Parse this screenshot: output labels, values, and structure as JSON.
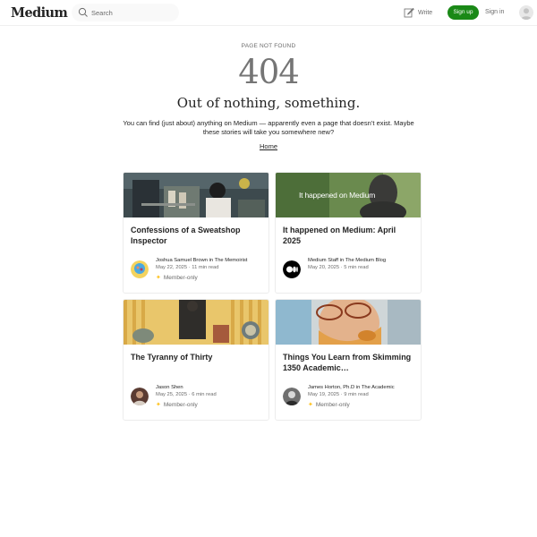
{
  "header": {
    "logo": "Medium",
    "search_placeholder": "Search",
    "write_label": "Write",
    "signup_label": "Sign up",
    "signin_label": "Sign in"
  },
  "not_found": {
    "label": "PAGE NOT FOUND",
    "code": "404",
    "title": "Out of nothing, something.",
    "description": "You can find (just about) anything on Medium — apparently even a page that doesn’t exist. Maybe these stories will take you somewhere new?",
    "home_link": "Home"
  },
  "stories": [
    {
      "title": "Confessions of a Sweatshop Inspector",
      "author": "Joshua Samuel Brown",
      "publication": "The Memoirist",
      "date": "May 22, 2025",
      "read_time": "11 min read",
      "member_only": "Member-only"
    },
    {
      "title": "It happened on Medium: April 2025",
      "author": "Medium Staff",
      "publication": "The Medium Blog",
      "date": "May 20, 2025",
      "read_time": "5 min read",
      "image_text": "It happened on Medium"
    },
    {
      "title": "The Tyranny of Thirty",
      "author": "Jason Shen",
      "publication": "",
      "date": "May 25, 2025",
      "read_time": "6 min read",
      "member_only": "Member-only"
    },
    {
      "title": "Things You Learn from Skimming 1350 Academic…",
      "author": "James Horton, Ph.D",
      "publication": "The Academic",
      "date": "May 19, 2025",
      "read_time": "9 min read",
      "member_only": "Member-only"
    }
  ],
  "colors": {
    "brand_green": "#1a8917",
    "member_star": "#ffc017",
    "muted_text": "#6b6b6b"
  }
}
